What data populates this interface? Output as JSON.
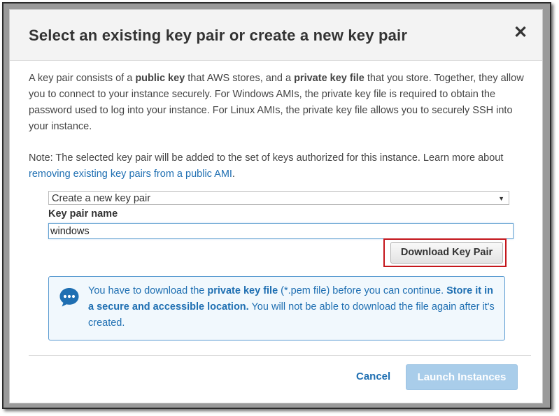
{
  "dialog": {
    "title": "Select an existing key pair or create a new key pair",
    "close_glyph": "✕",
    "description": {
      "t1": "A key pair consists of a ",
      "b1": "public key",
      "t2": " that AWS stores, and a ",
      "b2": "private key file",
      "t3": " that you store. Together, they allow you to connect to your instance securely. For Windows AMIs, the private key file is required to obtain the password used to log into your instance. For Linux AMIs, the private key file allows you to securely SSH into your instance."
    },
    "note": {
      "text": "Note: The selected key pair will be added to the set of keys authorized for this instance. Learn more about ",
      "link": "removing existing key pairs from a public AMI",
      "end": "."
    },
    "key_select": {
      "selected": "Create a new key pair",
      "arrow": "▼"
    },
    "key_name": {
      "label": "Key pair name",
      "value": "windows"
    },
    "download_button": "Download Key Pair",
    "info": {
      "t1": "You have to download the ",
      "b1": "private key file",
      "t2": " (*.pem file) before you can continue. ",
      "b2": "Store it in a secure and accessible location.",
      "t3": " You will not be able to download the file again after it's created."
    },
    "footer": {
      "cancel": "Cancel",
      "launch": "Launch Instances"
    }
  },
  "colors": {
    "link": "#1f6fb2",
    "highlight": "#c4161c",
    "info_border": "#5b9bd1",
    "info_bg": "#f1f8fd",
    "launch_bg": "#a9cdea"
  },
  "icons": {
    "info": "chat-bubble-icon",
    "close": "close-icon",
    "select_arrow": "caret-down-icon"
  }
}
